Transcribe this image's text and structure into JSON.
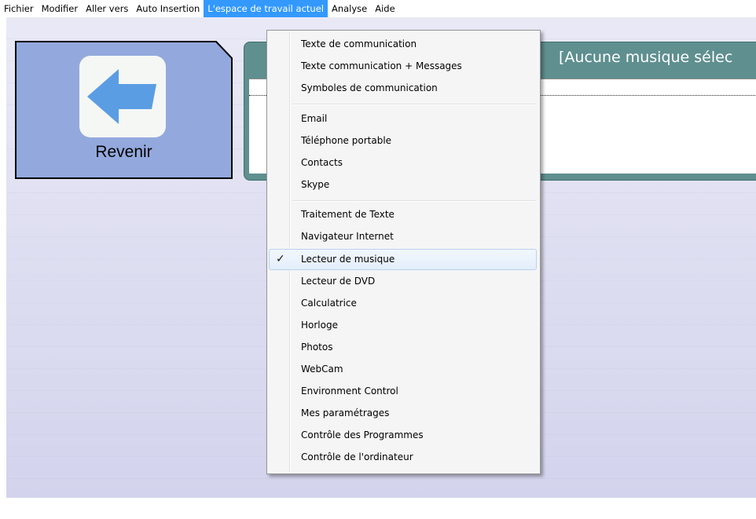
{
  "menubar": {
    "items": [
      "Fichier",
      "Modifier",
      "Aller vers",
      "Auto Insertion",
      "L'espace de travail actuel",
      "Analyse",
      "Aide"
    ]
  },
  "back_tile": {
    "label": "Revenir",
    "icon": "arrow-left-icon",
    "colors": {
      "tile": "#93a9dd",
      "arrow": "#5b9de3",
      "icon_bg": "#f4f7f4"
    }
  },
  "music_panel": {
    "title": "[Aucune musique sélec"
  },
  "dropdown": {
    "groups": [
      [
        "Texte de communication",
        "Texte communication + Messages",
        "Symboles de communication"
      ],
      [
        "Email",
        "Téléphone portable",
        "Contacts",
        "Skype"
      ],
      [
        "Traitement de Texte",
        "Navigateur Internet",
        "Lecteur de musique",
        "Lecteur de DVD",
        "Calculatrice",
        "Horloge",
        "Photos",
        "WebCam",
        "Environment Control",
        "Mes paramétrages",
        "Contrôle des Programmes",
        "Contrôle de l'ordinateur"
      ]
    ],
    "checked_item": "Lecteur de musique",
    "check_glyph": "✓"
  },
  "colors": {
    "menu_highlight": "#3399ff",
    "panel_header": "#5f8f8f",
    "workspace": "#e9e9f6"
  }
}
